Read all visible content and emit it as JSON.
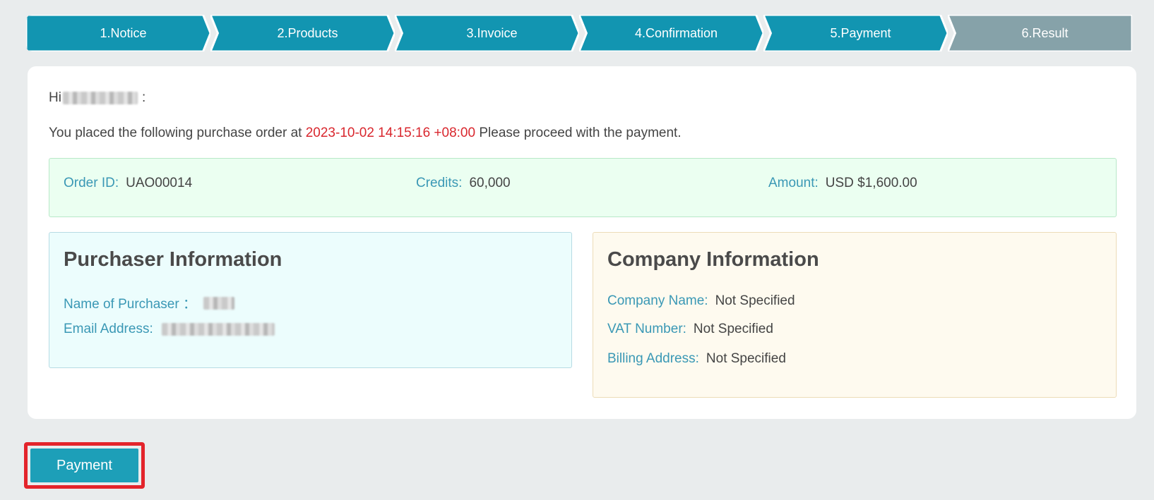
{
  "steps": [
    {
      "label": "1.Notice",
      "state": "done"
    },
    {
      "label": "2.Products",
      "state": "done"
    },
    {
      "label": "3.Invoice",
      "state": "done"
    },
    {
      "label": "4.Confirmation",
      "state": "done"
    },
    {
      "label": "5.Payment",
      "state": "current"
    },
    {
      "label": "6.Result",
      "state": "pending"
    }
  ],
  "colors": {
    "step_active": "#1295b1",
    "step_inactive": "#86a2a9",
    "timestamp": "#d9272e",
    "label": "#3a98b5",
    "button": "#1d9fb8",
    "highlight": "#e3242b"
  },
  "greeting": {
    "prefix": "Hi",
    "suffix": ":"
  },
  "intro": {
    "before": "You placed the following purchase order at",
    "timestamp": "2023-10-02 14:15:16 +08:00",
    "after": "Please proceed with the payment."
  },
  "order": {
    "order_id_label": "Order ID:",
    "order_id": "UAO00014",
    "credits_label": "Credits:",
    "credits": "60,000",
    "amount_label": "Amount:",
    "amount": "USD $1,600.00"
  },
  "purchaser": {
    "title": "Purchaser Information",
    "name_label": "Name of Purchaser ：",
    "email_label": "Email Address:"
  },
  "company": {
    "title": "Company Information",
    "name_label": "Company Name:",
    "name_value": "Not Specified",
    "vat_label": "VAT Number:",
    "vat_value": "Not Specified",
    "billing_label": "Billing Address:",
    "billing_value": "Not Specified"
  },
  "actions": {
    "payment_label": "Payment"
  }
}
